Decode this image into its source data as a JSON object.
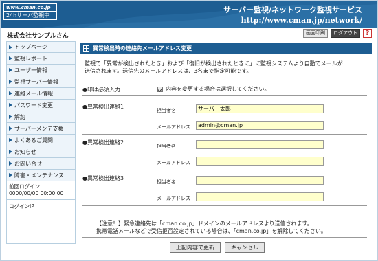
{
  "header": {
    "logo_url": "www.cman.co.jp",
    "logo_sub": "24hサーバ監視中",
    "brand_title": "サーバー監視/ネットワーク監視サービス",
    "brand_url": "http://www.cman.jp/network/"
  },
  "company": "株式会社サンプルさん",
  "top_buttons": {
    "print": "画面印刷",
    "logout": "ログアウト",
    "help": "?"
  },
  "sidebar": {
    "items": [
      {
        "label": "トップページ"
      },
      {
        "label": "監視レポート"
      },
      {
        "label": "ユーザー情報"
      },
      {
        "label": "監視サーバー情報"
      },
      {
        "label": "連絡メール情報"
      },
      {
        "label": "パスワード変更"
      },
      {
        "label": "解約"
      },
      {
        "label": "サーバーメンテ支援"
      },
      {
        "label": "よくあるご質問"
      },
      {
        "label": "お知らせ"
      },
      {
        "label": "お問い合せ"
      },
      {
        "label": "障害・メンテナンス"
      }
    ],
    "last_login_label": "前回ログイン",
    "last_login_value": "0000/00/00 00:00:00",
    "login_ip_label": "ログインIP"
  },
  "main": {
    "title": "異常検出時の連絡先メールアドレス変更",
    "desc_line1": "監視で「異常が検出されたとき」および「復旧が検出されたときに」に監視システムより自動でメールが",
    "desc_line2": "送信されます。送信先のメールアドレスは、3名まで指定可能です。",
    "required_label": "●印は必須入力",
    "check_label": "内容を変更する場合は選択してください。",
    "contacts": [
      {
        "group": "●異常検出連絡1",
        "name_label": "担当者名",
        "email_label": "メールアドレス",
        "name": "サーバ　太郎",
        "email": "admin@cman.jp"
      },
      {
        "group": "●異常検出連絡2",
        "name_label": "担当者名",
        "email_label": "メールアドレス",
        "name": "",
        "email": ""
      },
      {
        "group": "●異常検出連絡3",
        "name_label": "担当者名",
        "email_label": "メールアドレス",
        "name": "",
        "email": ""
      }
    ],
    "note_line1": "【注意！】緊急連絡先は「cman.co.jp」ドメインのメールアドレスより送信されます。",
    "note_line2": "携帯電話メールなどで受信拒否設定されている場合は、「cman.co.jp」を解除してください。",
    "submit_label": "上記内容で更新",
    "cancel_label": "キャンセル"
  }
}
